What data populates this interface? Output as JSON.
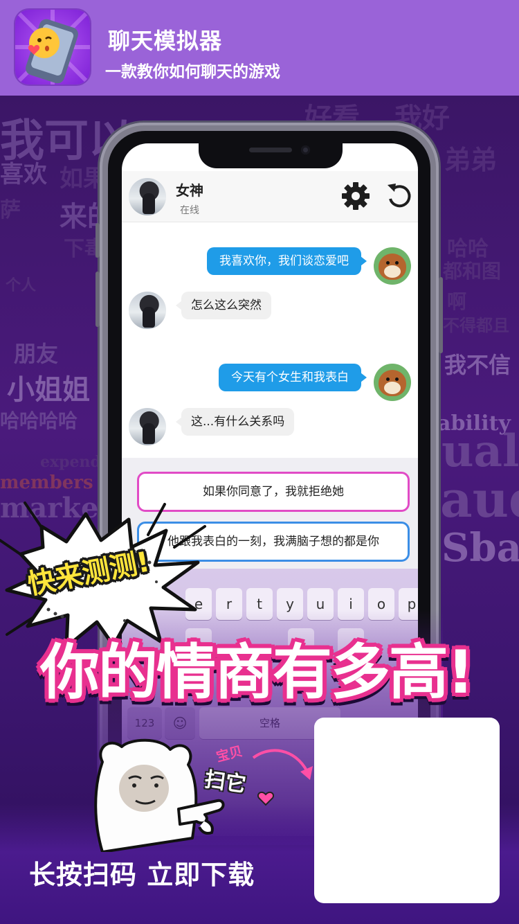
{
  "header": {
    "app_title": "聊天模拟器",
    "app_subtitle": "一款教你如何聊天的游戏"
  },
  "background_words": [
    "我可以",
    "如果",
    "喜欢",
    "萨",
    "来的",
    "下毒",
    "个人",
    "朋友",
    "小姐姐",
    "哈哈哈哈",
    "我不信",
    "好看",
    "弟弟",
    "我好",
    "哈哈",
    "都和图",
    "啊",
    "不得都且",
    "members",
    "markets",
    "ability",
    "expend",
    "ual",
    "aud",
    "Sba"
  ],
  "chat": {
    "contact_name": "女神",
    "contact_status": "在线",
    "messages": [
      {
        "from": "me",
        "text": "我喜欢你，我们谈恋爱吧"
      },
      {
        "from": "other",
        "text": "怎么这么突然"
      },
      {
        "from": "me",
        "text": "今天有个女生和我表白"
      },
      {
        "from": "other",
        "text": "这...有什么关系吗"
      }
    ],
    "options": [
      {
        "text": "如果你同意了，我就拒绝她"
      },
      {
        "text": "他跟我表白的一刻，我满脑子想的都是你"
      }
    ]
  },
  "keyboard": {
    "row1": [
      "e",
      "r",
      "t",
      "y",
      "u",
      "i",
      "o",
      "p"
    ],
    "num_key": "123",
    "emoji_key": "☺",
    "space_key": "空格"
  },
  "promo": {
    "burst_text": "快来测测!",
    "headline": "你的情商有多高!",
    "baobei": "宝贝",
    "saota": "扫它",
    "cta": "长按扫码   立即下载"
  },
  "colors": {
    "header_bg": "#9a63d8",
    "bubble_me": "#1f9ce8",
    "option1_border": "#e14bc6",
    "option2_border": "#3b8ee6",
    "headline_stroke": "#e8308f",
    "burst_text": "#ffe53b"
  }
}
